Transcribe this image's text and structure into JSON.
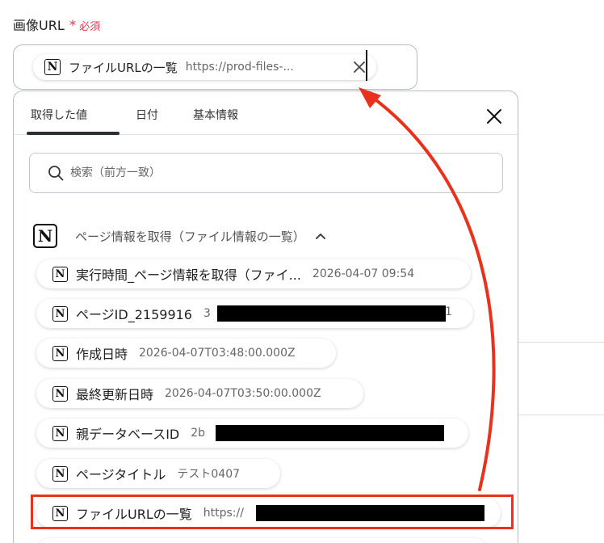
{
  "field": {
    "label": "画像URL",
    "required_mark": "*",
    "required_text": "必須"
  },
  "input": {
    "chip_label": "ファイルURLの一覧",
    "chip_value": "https://prod-files-..."
  },
  "tabs": [
    {
      "label": "取得した値",
      "active": true
    },
    {
      "label": "日付",
      "active": false
    },
    {
      "label": "基本情報",
      "active": false
    }
  ],
  "search": {
    "placeholder": "検索（前方一致）"
  },
  "group": {
    "title": "ページ情報を取得（ファイル情報の一覧）"
  },
  "items": [
    {
      "label": "実行時間_ページ情報を取得（ファイ...",
      "value": "2026-04-07 09:54"
    },
    {
      "label": "ページID_2159916",
      "value": "3"
    },
    {
      "label": "作成日時",
      "value": "2026-04-07T03:48:00.000Z"
    },
    {
      "label": "最終更新日時",
      "value": "2026-04-07T03:50:00.000Z"
    },
    {
      "label": "親データベースID",
      "value": "2b"
    },
    {
      "label": "ページタイトル",
      "value": "テスト0407"
    },
    {
      "label": "ファイルURLの一覧",
      "value": "https://"
    }
  ],
  "item_id_tail": "1",
  "colors": {
    "accent_red": "#e8321e",
    "required": "#e8344e"
  },
  "icons": {
    "notion": "N"
  }
}
